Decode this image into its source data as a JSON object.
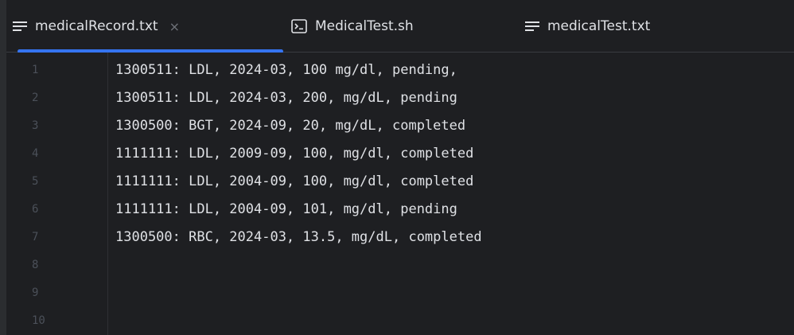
{
  "tabs": [
    {
      "label": "medicalRecord.txt",
      "icon": "text-file-icon",
      "active": true,
      "closable": true
    },
    {
      "label": "MedicalTest.sh",
      "icon": "terminal-file-icon",
      "active": false,
      "closable": false
    },
    {
      "label": "medicalTest.txt",
      "icon": "text-file-icon",
      "active": false,
      "closable": false
    }
  ],
  "close_glyph": "×",
  "colors": {
    "background": "#1e1f22",
    "accent": "#3574f0",
    "text": "#dfe1e5",
    "line_number": "#4b5059"
  },
  "editor": {
    "line_numbers": [
      "1",
      "2",
      "3",
      "4",
      "5",
      "6",
      "7",
      "8",
      "9",
      "10"
    ],
    "lines": [
      "1300511: LDL, 2024-03, 100 mg/dl, pending,",
      "1300511: LDL, 2024-03, 200, mg/dL, pending",
      "1300500: BGT, 2024-09, 20, mg/dL, completed",
      "1111111: LDL, 2009-09, 100, mg/dl, completed",
      "1111111: LDL, 2004-09, 100, mg/dl, completed",
      "1111111: LDL, 2004-09, 101, mg/dl, pending",
      "1300500: RBC, 2024-03, 13.5, mg/dL, completed",
      "",
      "",
      ""
    ]
  }
}
